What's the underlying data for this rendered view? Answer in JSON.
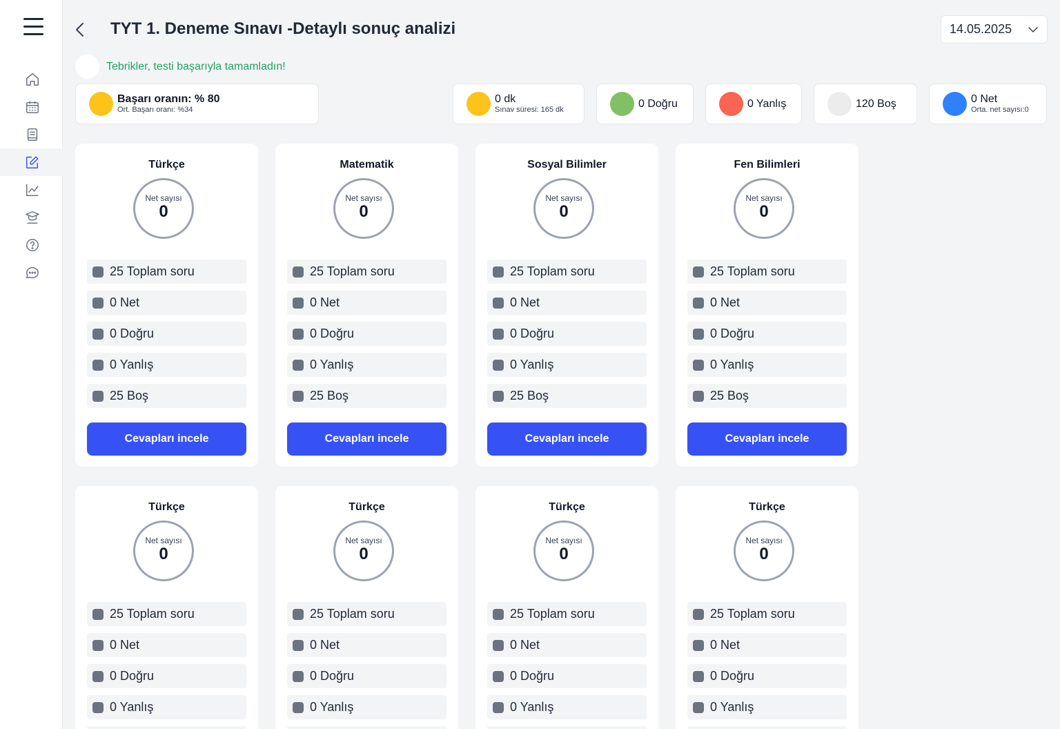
{
  "header": {
    "title": "TYT 1. Deneme Sınavı -Detaylı sonuç analizi",
    "date": "14.05.2025"
  },
  "congrats": "Tebrikler, testi başarıyla tamamladın!",
  "sidebar": {
    "items": [
      {
        "name": "home-icon"
      },
      {
        "name": "calendar-icon"
      },
      {
        "name": "book-icon"
      },
      {
        "name": "edit-icon",
        "active": true
      },
      {
        "name": "chart-icon"
      },
      {
        "name": "graduation-icon"
      },
      {
        "name": "help-icon"
      },
      {
        "name": "chat-icon"
      }
    ]
  },
  "summary": {
    "success_main": "Başarı oranın: % 80",
    "success_sub": "Ort. Başarı oranı: %34",
    "duration_main": "0 dk",
    "duration_sub": "Sınav süresi: 165 dk",
    "correct": "0 Doğru",
    "wrong": "0 Yanlış",
    "empty": "120 Boş",
    "net_main": "0 Net",
    "net_sub": "Orta. net sayısı:0"
  },
  "colors": {
    "success": "#fcc419",
    "duration": "#fcc419",
    "correct": "#82c065",
    "wrong": "#fa6452",
    "empty": "#ececec",
    "net": "#2f80ff",
    "button": "#3652f5"
  },
  "net_label": "Net sayısı",
  "button_label": "Cevapları incele",
  "cards": [
    {
      "subject": "Türkçe",
      "net": "0",
      "rows": [
        "25 Toplam soru",
        "0 Net",
        "0 Doğru",
        "0 Yanlış",
        "25 Boş"
      ]
    },
    {
      "subject": "Matematik",
      "net": "0",
      "rows": [
        "25 Toplam soru",
        "0 Net",
        "0 Doğru",
        "0 Yanlış",
        "25 Boş"
      ]
    },
    {
      "subject": "Sosyal Bilimler",
      "net": "0",
      "rows": [
        "25 Toplam soru",
        "0 Net",
        "0 Doğru",
        "0 Yanlış",
        "25 Boş"
      ]
    },
    {
      "subject": "Fen Bilimleri",
      "net": "0",
      "rows": [
        "25 Toplam soru",
        "0 Net",
        "0 Doğru",
        "0 Yanlış",
        "25 Boş"
      ]
    },
    {
      "subject": "Türkçe",
      "net": "0",
      "rows": [
        "25 Toplam soru",
        "0 Net",
        "0 Doğru",
        "0 Yanlış"
      ]
    },
    {
      "subject": "Türkçe",
      "net": "0",
      "rows": [
        "25 Toplam soru",
        "0 Net",
        "0 Doğru",
        "0 Yanlış"
      ]
    },
    {
      "subject": "Türkçe",
      "net": "0",
      "rows": [
        "25 Toplam soru",
        "0 Net",
        "0 Doğru",
        "0 Yanlış"
      ]
    },
    {
      "subject": "Türkçe",
      "net": "0",
      "rows": [
        "25 Toplam soru",
        "0 Net",
        "0 Doğru",
        "0 Yanlış"
      ]
    }
  ]
}
